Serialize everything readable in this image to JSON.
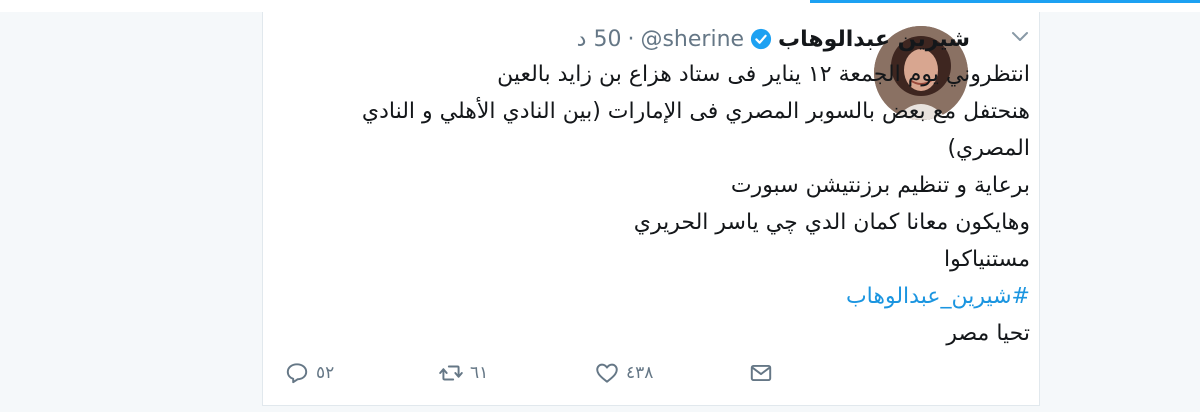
{
  "tweet": {
    "display_name": "شيرين عبدالوهاب",
    "handle": "@sherine",
    "separator": "·",
    "time": "50 د",
    "lines": [
      "انتظروني يوم الجمعة ١٢ يناير فى ستاد هزاع بن زايد بالعين",
      "هنحتفل مع بعض بالسوبر المصري فى الإمارات (بين النادي الأهلي و النادي",
      "المصري)",
      "برعاية و تنظيم برزنتيشن سبورت",
      "وهايكون معانا كمان الدي چي ياسر الحريري",
      "مستنياكوا"
    ],
    "hashtag": "#شيرين_عبدالوهاب",
    "closing": "تحيا مصر"
  },
  "actions": {
    "reply_count": "٥٢",
    "retweet_count": "٦١",
    "like_count": "٤٣٨"
  },
  "icons": {
    "verified": "verified-badge-icon",
    "more": "chevron-down-icon",
    "reply": "reply-icon",
    "retweet": "retweet-icon",
    "like": "heart-icon",
    "dm": "envelope-icon"
  },
  "colors": {
    "accent": "#1da1f2",
    "hashtag": "#1b95e0",
    "text": "#14171a",
    "muted": "#657786"
  }
}
